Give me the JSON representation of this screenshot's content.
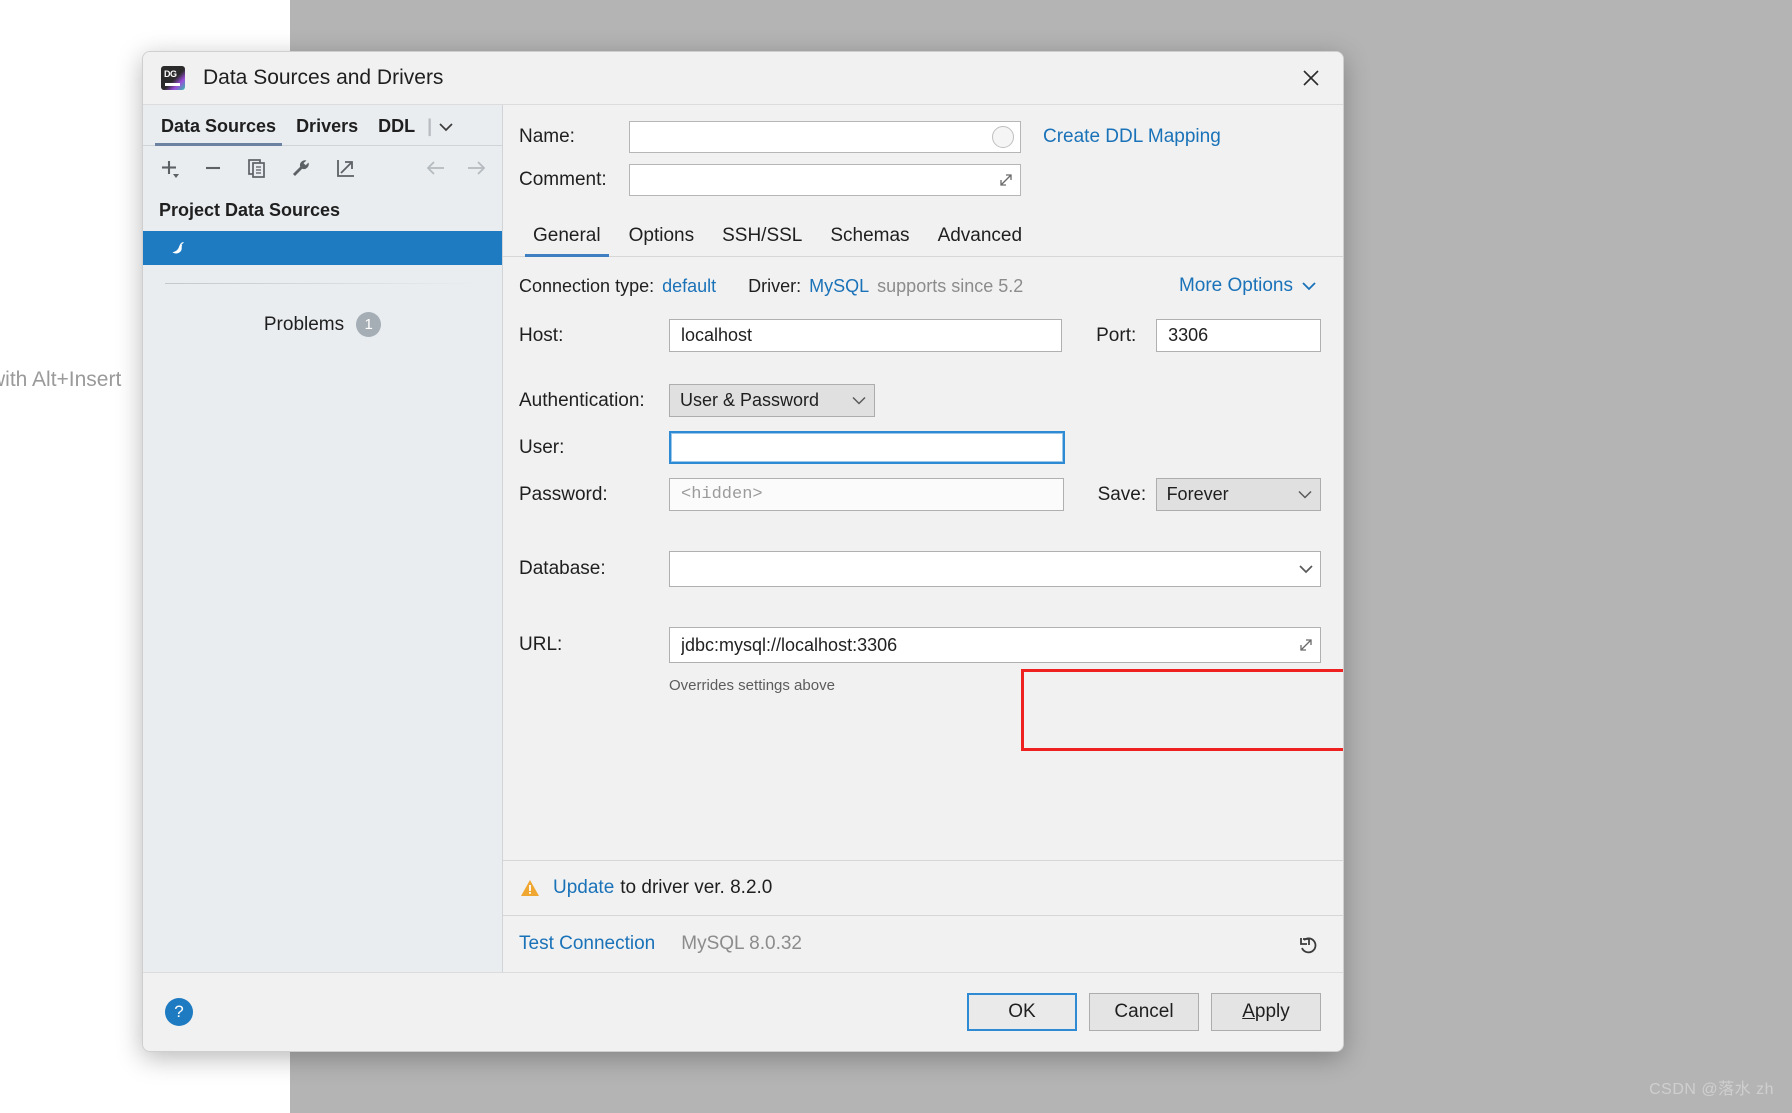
{
  "desktop": {
    "background_hint": "with Alt+Insert",
    "watermark": "CSDN @落水 zh"
  },
  "dialog": {
    "title": "Data Sources and Drivers",
    "app_icon": "datagrip-icon",
    "close_label": "×"
  },
  "left_panel": {
    "tabs": [
      {
        "label": "Data Sources",
        "active": true
      },
      {
        "label": "Drivers",
        "active": false
      },
      {
        "label": "DDL",
        "active": false
      }
    ],
    "more_tabs_glyph": "⌄",
    "toolbar": [
      {
        "name": "add-button",
        "glyph": "+"
      },
      {
        "name": "remove-button",
        "glyph": "−"
      },
      {
        "name": "copy-button",
        "glyph": "copy-icon"
      },
      {
        "name": "properties-button",
        "glyph": "wrench-icon"
      },
      {
        "name": "export-button",
        "glyph": "export-icon"
      },
      {
        "name": "back-button",
        "glyph": "←"
      },
      {
        "name": "forward-button",
        "glyph": "→"
      }
    ],
    "group_header": "Project Data Sources",
    "data_sources": [
      {
        "name": "mysql-data-source",
        "icon": "mysql-dolphin-icon",
        "label": "",
        "selected": true
      }
    ],
    "problems": {
      "label": "Problems",
      "count": "1"
    }
  },
  "form": {
    "name": {
      "label": "Name:",
      "value": "",
      "placeholder": ""
    },
    "comment": {
      "label": "Comment:",
      "value": "",
      "placeholder": ""
    },
    "create_ddl_link": "Create DDL Mapping",
    "tabs": [
      {
        "label": "General",
        "active": true
      },
      {
        "label": "Options",
        "active": false
      },
      {
        "label": "SSH/SSL",
        "active": false
      },
      {
        "label": "Schemas",
        "active": false
      },
      {
        "label": "Advanced",
        "active": false
      }
    ],
    "connection_type_label": "Connection type:",
    "connection_type_value": "default",
    "driver_label": "Driver:",
    "driver_value": "MySQL",
    "driver_supports": "supports since 5.2",
    "more_options": "More Options",
    "host": {
      "label": "Host:",
      "value": "localhost"
    },
    "port": {
      "label": "Port:",
      "value": "3306"
    },
    "authentication": {
      "label": "Authentication:",
      "value": "User & Password"
    },
    "user": {
      "label": "User:",
      "value": "",
      "focused": true
    },
    "password": {
      "label": "Password:",
      "value": "",
      "placeholder": "<hidden>"
    },
    "save": {
      "label": "Save:",
      "value": "Forever"
    },
    "database": {
      "label": "Database:",
      "value": ""
    },
    "url": {
      "label": "URL:",
      "value": "jdbc:mysql://localhost:3306"
    },
    "url_hint": "Overrides settings above"
  },
  "status": {
    "warning_icon": "warning-triangle-icon",
    "update_link": "Update",
    "update_rest": "to driver ver. 8.2.0",
    "test_connection": "Test Connection",
    "db_version": "MySQL 8.0.32",
    "revert_icon": "revert-icon"
  },
  "footer": {
    "help_label": "?",
    "ok": "OK",
    "cancel": "Cancel",
    "apply_underlined": "A",
    "apply_rest": "pply"
  },
  "colors": {
    "accent_blue": "#1f7bc1",
    "link_blue": "#1a72b8",
    "highlight_red": "#ef2020",
    "selection_blue": "#1f7bc1",
    "warning_orange": "#f0a732"
  }
}
